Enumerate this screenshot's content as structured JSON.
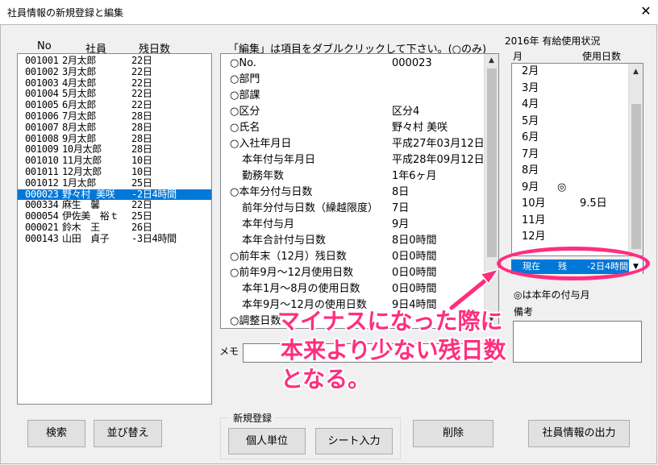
{
  "window": {
    "title": "社員情報の新規登録と編集",
    "close_glyph": "✕"
  },
  "employee_list": {
    "headers": {
      "no": "No",
      "name": "社員",
      "days": "残日数"
    },
    "rows": [
      {
        "no": "001001",
        "name": "2月太郎",
        "days": "22日"
      },
      {
        "no": "001002",
        "name": "3月太郎",
        "days": "22日"
      },
      {
        "no": "001003",
        "name": "4月太郎",
        "days": "22日"
      },
      {
        "no": "001004",
        "name": "5月太郎",
        "days": "22日"
      },
      {
        "no": "001005",
        "name": "6月太郎",
        "days": "22日"
      },
      {
        "no": "001006",
        "name": "7月太郎",
        "days": "28日"
      },
      {
        "no": "001007",
        "name": "8月太郎",
        "days": "28日"
      },
      {
        "no": "001008",
        "name": "9月太郎",
        "days": "28日"
      },
      {
        "no": "001009",
        "name": "10月太郎",
        "days": "28日"
      },
      {
        "no": "001010",
        "name": "11月太郎",
        "days": "10日"
      },
      {
        "no": "001011",
        "name": "12月太郎",
        "days": "10日"
      },
      {
        "no": "001012",
        "name": "1月太郎",
        "days": "25日"
      },
      {
        "no": "000023",
        "name": "野々村 美咲",
        "days": "-2日4時間",
        "selected": true
      },
      {
        "no": "000334",
        "name": "麻生　馨",
        "days": "22日"
      },
      {
        "no": "000054",
        "name": "伊佐美　裕ｔ",
        "days": "25日"
      },
      {
        "no": "000021",
        "name": "鈴木　王",
        "days": "26日"
      },
      {
        "no": "000143",
        "name": "山田　貞子",
        "days": "-3日4時間"
      }
    ]
  },
  "details": {
    "instruction": "「編集」は項目をダブルクリックして下さい。(○のみ)",
    "rows": [
      {
        "label": "○No.",
        "value": "000023"
      },
      {
        "label": "○部門",
        "value": ""
      },
      {
        "label": "○部課",
        "value": ""
      },
      {
        "label": "○区分",
        "value": "区分4"
      },
      {
        "label": "○氏名",
        "value": "野々村 美咲"
      },
      {
        "label": "○入社年月日",
        "value": "平成27年03月12日"
      },
      {
        "label": "本年付与年月日",
        "value": "平成28年09月12日",
        "indent": true
      },
      {
        "label": "勤務年数",
        "value": "1年6ヶ月",
        "indent": true
      },
      {
        "label": "○本年分付与日数",
        "value": "8日"
      },
      {
        "label": "前年分付与日数（繰越限度）",
        "value": "7日",
        "indent": true
      },
      {
        "label": "本年付与月",
        "value": "9月",
        "indent": true
      },
      {
        "label": "本年合計付与日数",
        "value": "8日0時間",
        "indent": true
      },
      {
        "label": "○前年末（12月）残日数",
        "value": "0日0時間"
      },
      {
        "label": "○前年9月～12月使用日数",
        "value": "0日0時間"
      },
      {
        "label": "本年1月～8月の使用日数",
        "value": "0日0時間",
        "indent": true
      },
      {
        "label": "本年9月～12月の使用日数",
        "value": "9日4時間",
        "indent": true
      },
      {
        "label": "○調整日数",
        "value": ""
      }
    ]
  },
  "memo": {
    "label": "メモ",
    "value": ""
  },
  "usage": {
    "title": "2016年  有給使用状況",
    "col_month": "月",
    "col_days": "使用日数",
    "months": [
      {
        "month": "2月",
        "mark": "",
        "days": ""
      },
      {
        "month": "3月",
        "mark": "",
        "days": ""
      },
      {
        "month": "4月",
        "mark": "",
        "days": ""
      },
      {
        "month": "5月",
        "mark": "",
        "days": ""
      },
      {
        "month": "6月",
        "mark": "",
        "days": ""
      },
      {
        "month": "7月",
        "mark": "",
        "days": ""
      },
      {
        "month": "8月",
        "mark": "",
        "days": ""
      },
      {
        "month": "9月",
        "mark": "◎",
        "days": ""
      },
      {
        "month": "10月",
        "mark": "",
        "days": "9.5日"
      },
      {
        "month": "11月",
        "mark": "",
        "days": ""
      },
      {
        "month": "12月",
        "mark": "",
        "days": ""
      }
    ],
    "current_label": "現在　　残",
    "current_value": "-2日4時間",
    "legend_note": "◎は本年の付与月",
    "remarks_label": "備考",
    "remarks_value": ""
  },
  "buttons": {
    "search": "検索",
    "sort": "並び替え",
    "new_group_label": "新規登録",
    "individual": "個人単位",
    "sheet_input": "シート入力",
    "delete": "削除",
    "export": "社員情報の出力"
  },
  "annotation": {
    "line1": "マイナスになった際に",
    "line2": "本来より少ない残日数",
    "line3": "となる。",
    "color": "#ff2e7e"
  }
}
